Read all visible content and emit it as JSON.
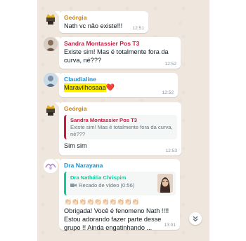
{
  "messages": [
    {
      "sender": "Geórgia",
      "sender_color": "#c8841e",
      "text": "Nath vc não existe!!!",
      "time": "12:51"
    },
    {
      "sender": "Sandra Montassier Pos T3",
      "sender_color": "#cf1a3e",
      "text": "Existe sim! Mas é totalmente fora da curva, né???",
      "time": "12:52"
    },
    {
      "sender": "Claudialine",
      "sender_color": "#1f8ec9",
      "text": "Maravilhosaaa",
      "emoji": "❤️",
      "time": "12:52"
    },
    {
      "sender": "Geórgia",
      "sender_color": "#c8841e",
      "quote": {
        "sender": "Sandra Montassier Pos T3",
        "text": "Existe sim! Mas é totalmente fora da curva, né???"
      },
      "text": "Sim sim",
      "time": "12:53"
    },
    {
      "sender": "Dra Narayana",
      "sender_color": "#1f8ec9",
      "quote": {
        "sender": "Dra Nathália Chrispim",
        "video_label": "Recado de vídeo (0:56)"
      },
      "emoji_row": "👏🏻👏🏻👏🏻👏🏻👏🏻👏🏻👏🏻👏🏻👏🏻👏🏻",
      "text": "Obrigada! Você é fenomeno Nath !!!! Estou adorando fazer parte desse grupo !! Ainda engatinhando ...",
      "time": "13:01"
    }
  ]
}
